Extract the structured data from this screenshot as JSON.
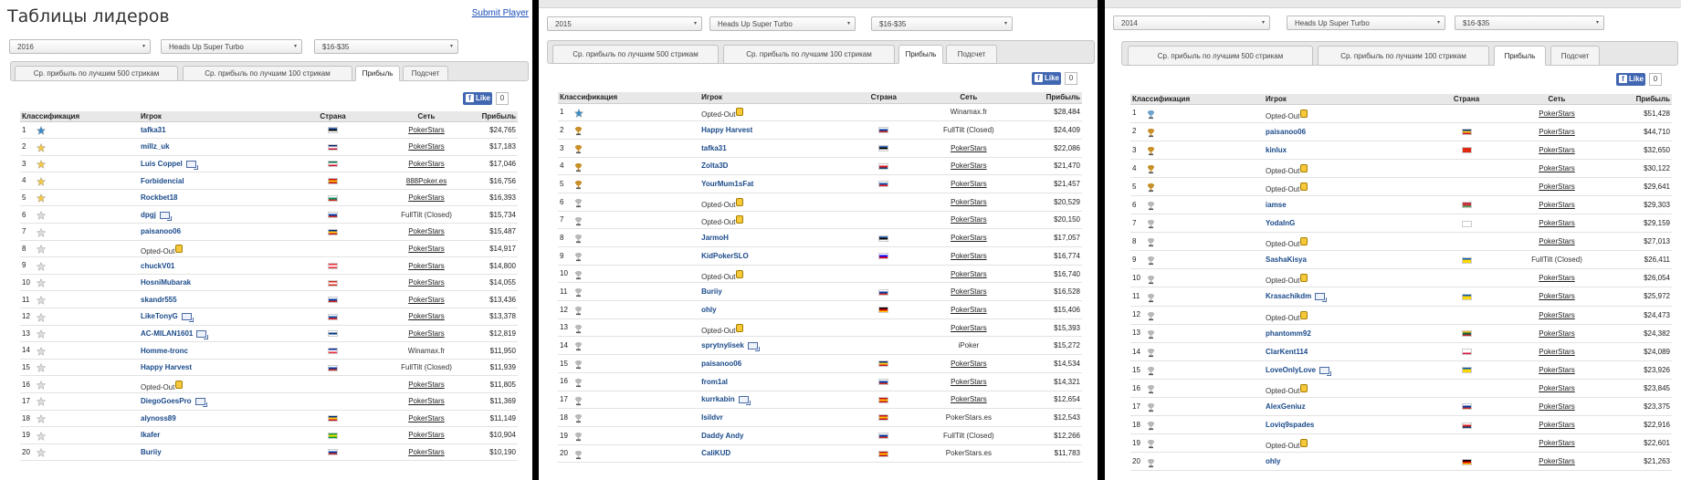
{
  "panels": [
    {
      "title": "Таблицы лидеров",
      "submit": "Submit Player",
      "filters": {
        "year": "2016",
        "game": "Heads Up Super Turbo",
        "stakes": "$16-$35"
      },
      "tabs": [
        "Ср. прибыль по лучшим 500 стрикам",
        "Ср. прибыль по лучшим 100 стрикам",
        "Прибыль",
        "Подсчет"
      ],
      "active_tab": 2,
      "fb": {
        "like": "Like",
        "count": "0"
      },
      "headers": {
        "rank": "Классификация",
        "player": "Игрок",
        "country": "Страна",
        "network": "Сеть",
        "profit": "Прибыль"
      },
      "rows": [
        {
          "rank": "1",
          "icon": "star-blue",
          "player": "tafka31",
          "flag": "ee",
          "network": "PokerStars",
          "profit": "$24,765"
        },
        {
          "rank": "2",
          "icon": "star-gold",
          "player": "millz_uk",
          "flag": "gb",
          "network": "PokerStars",
          "profit": "$17,183"
        },
        {
          "rank": "3",
          "icon": "star-gold",
          "player": "Luis Coppel",
          "popup": true,
          "flag": "mx",
          "network": "PokerStars",
          "profit": "$17,046"
        },
        {
          "rank": "4",
          "icon": "star-gold",
          "player": "Forbidencial",
          "flag": "es",
          "network": "888Poker.es",
          "profit": "$16,756"
        },
        {
          "rank": "5",
          "icon": "star-gold",
          "player": "Rockbet18",
          "flag": "bg",
          "network": "PokerStars",
          "profit": "$16,393"
        },
        {
          "rank": "6",
          "icon": "star-grey",
          "player": "dpgj",
          "popup": true,
          "flag": "ru",
          "network": "FullTilt (Closed)",
          "profit": "$15,734"
        },
        {
          "rank": "7",
          "icon": "star-grey",
          "player": "paisanoo06",
          "flag": "ro",
          "network": "PokerStars",
          "profit": "$15,487"
        },
        {
          "rank": "8",
          "icon": "star-grey",
          "player": "Opted-Out",
          "optout": true,
          "flag": "",
          "network": "PokerStars",
          "profit": "$14,917"
        },
        {
          "rank": "9",
          "icon": "star-grey",
          "player": "chuckV01",
          "flag": "at",
          "network": "PokerStars",
          "profit": "$14,800"
        },
        {
          "rank": "10",
          "icon": "star-grey",
          "player": "HosniMubarak",
          "flag": "ca",
          "network": "PokerStars",
          "profit": "$14,055"
        },
        {
          "rank": "11",
          "icon": "star-grey",
          "player": "skandr555",
          "flag": "ru",
          "network": "PokerStars",
          "profit": "$13,436"
        },
        {
          "rank": "12",
          "icon": "star-grey",
          "player": "LikeTonyG",
          "popup": true,
          "flag": "sk",
          "network": "PokerStars",
          "profit": "$13,378"
        },
        {
          "rank": "13",
          "icon": "star-grey",
          "player": "AC-MILAN1601",
          "popup": true,
          "flag": "fi",
          "network": "PokerStars",
          "profit": "$12,819"
        },
        {
          "rank": "14",
          "icon": "star-grey",
          "player": "Homme-tronc",
          "flag": "fr",
          "network": "Winamax.fr",
          "profit": "$11,950"
        },
        {
          "rank": "15",
          "icon": "star-grey",
          "player": "Happy Harvest",
          "flag": "ru",
          "network": "FullTilt (Closed)",
          "profit": "$11,939"
        },
        {
          "rank": "16",
          "icon": "star-grey",
          "player": "Opted-Out",
          "optout": true,
          "flag": "",
          "network": "PokerStars",
          "profit": "$11,805"
        },
        {
          "rank": "17",
          "icon": "star-grey",
          "player": "DiegoGoesPro",
          "popup": true,
          "flag": "",
          "network": "PokerStars",
          "profit": "$11,369"
        },
        {
          "rank": "18",
          "icon": "star-grey",
          "player": "alynoss89",
          "flag": "ro",
          "network": "PokerStars",
          "profit": "$11,149"
        },
        {
          "rank": "19",
          "icon": "star-grey",
          "player": "lkafer",
          "flag": "br",
          "network": "PokerStars",
          "profit": "$10,904"
        },
        {
          "rank": "20",
          "icon": "star-grey",
          "player": "Buriiy",
          "flag": "ru",
          "network": "PokerStars",
          "profit": "$10,190"
        }
      ]
    },
    {
      "filters": {
        "year": "2015",
        "game": "Heads Up Super Turbo",
        "stakes": "$16-$35"
      },
      "tabs": [
        "Ср. прибыль по лучшим 500 стрикам",
        "Ср. прибыль по лучшим 100 стрикам",
        "Прибыль",
        "Подсчет"
      ],
      "active_tab": 2,
      "fb": {
        "like": "Like",
        "count": "0"
      },
      "headers": {
        "rank": "Классификация",
        "player": "Игрок",
        "country": "Страна",
        "network": "Сеть",
        "profit": "Прибыль"
      },
      "rows": [
        {
          "rank": "1",
          "icon": "star-blue",
          "player": "Opted-Out",
          "optout": true,
          "flag": "",
          "network": "Winamax.fr",
          "profit": "$28,484"
        },
        {
          "rank": "2",
          "icon": "trophy",
          "player": "Happy Harvest",
          "flag": "ru",
          "network": "FullTilt (Closed)",
          "profit": "$24,409"
        },
        {
          "rank": "3",
          "icon": "trophy",
          "player": "tafka31",
          "flag": "ee",
          "network": "PokerStars",
          "profit": "$22,086"
        },
        {
          "rank": "4",
          "icon": "trophy",
          "player": "Zolta3D",
          "flag": "cz",
          "network": "PokerStars",
          "profit": "$21,470"
        },
        {
          "rank": "5",
          "icon": "trophy",
          "player": "YourMum1sFat",
          "flag": "sk",
          "network": "PokerStars",
          "profit": "$21,457"
        },
        {
          "rank": "6",
          "icon": "trophy-grey",
          "player": "Opted-Out",
          "optout": true,
          "flag": "",
          "network": "PokerStars",
          "profit": "$20,529"
        },
        {
          "rank": "7",
          "icon": "trophy-grey",
          "player": "Opted-Out",
          "optout": true,
          "flag": "",
          "network": "PokerStars",
          "profit": "$20,150"
        },
        {
          "rank": "8",
          "icon": "trophy-grey",
          "player": "JarmoH",
          "flag": "ee",
          "network": "PokerStars",
          "profit": "$17,057"
        },
        {
          "rank": "9",
          "icon": "trophy-grey",
          "player": "KidPokerSLO",
          "flag": "si",
          "network": "PokerStars",
          "profit": "$16,774"
        },
        {
          "rank": "10",
          "icon": "trophy-grey",
          "player": "Opted-Out",
          "optout": true,
          "flag": "",
          "network": "PokerStars",
          "profit": "$16,740"
        },
        {
          "rank": "11",
          "icon": "trophy-grey",
          "player": "Buriiy",
          "flag": "ru",
          "network": "PokerStars",
          "profit": "$16,528"
        },
        {
          "rank": "12",
          "icon": "trophy-grey",
          "player": "ohly",
          "flag": "de",
          "network": "PokerStars",
          "profit": "$15,406"
        },
        {
          "rank": "13",
          "icon": "trophy-grey",
          "player": "Opted-Out",
          "optout": true,
          "flag": "",
          "network": "PokerStars",
          "profit": "$15,393"
        },
        {
          "rank": "14",
          "icon": "trophy-grey",
          "player": "sprytnylisek",
          "popup": true,
          "flag": "",
          "network": "iPoker",
          "profit": "$15,272"
        },
        {
          "rank": "15",
          "icon": "trophy-grey",
          "player": "paisanoo06",
          "flag": "ro",
          "network": "PokerStars",
          "profit": "$14,534"
        },
        {
          "rank": "16",
          "icon": "trophy-grey",
          "player": "from1al",
          "flag": "ru",
          "network": "PokerStars",
          "profit": "$14,321"
        },
        {
          "rank": "17",
          "icon": "trophy-grey",
          "player": "kurrkabin",
          "popup": true,
          "flag": "es",
          "network": "PokerStars",
          "profit": "$12,654"
        },
        {
          "rank": "18",
          "icon": "trophy-grey",
          "player": "Isildvr",
          "flag": "es",
          "network": "PokerStars.es",
          "profit": "$12,543"
        },
        {
          "rank": "19",
          "icon": "trophy-grey",
          "player": "Daddy Andy",
          "flag": "ru",
          "network": "FullTilt (Closed)",
          "profit": "$12,266"
        },
        {
          "rank": "20",
          "icon": "trophy-grey",
          "player": "CaliKUD",
          "flag": "es",
          "network": "PokerStars.es",
          "profit": "$11,783"
        }
      ]
    },
    {
      "filters": {
        "year": "2014",
        "game": "Heads Up Super Turbo",
        "stakes": "$16-$35"
      },
      "tabs": [
        "Ср. прибыль по лучшим 500 стрикам",
        "Ср. прибыль по лучшим 100 стрикам",
        "Прибыль",
        "Подсчет"
      ],
      "active_tab": 2,
      "fb": {
        "like": "Like",
        "count": "0"
      },
      "headers": {
        "rank": "Классификация",
        "player": "Игрок",
        "country": "Страна",
        "network": "Сеть",
        "profit": "Прибыль"
      },
      "rows": [
        {
          "rank": "1",
          "icon": "trophy-blue",
          "player": "Opted-Out",
          "optout": true,
          "flag": "",
          "network": "PokerStars",
          "profit": "$51,428"
        },
        {
          "rank": "2",
          "icon": "trophy",
          "player": "paisanoo06",
          "flag": "ro",
          "network": "PokerStars",
          "profit": "$44,710"
        },
        {
          "rank": "3",
          "icon": "trophy",
          "player": "kinlux",
          "flag": "cn",
          "network": "PokerStars",
          "profit": "$32,650"
        },
        {
          "rank": "4",
          "icon": "trophy",
          "player": "Opted-Out",
          "optout": true,
          "flag": "",
          "network": "PokerStars",
          "profit": "$30,122"
        },
        {
          "rank": "5",
          "icon": "trophy",
          "player": "Opted-Out",
          "optout": true,
          "flag": "",
          "network": "PokerStars",
          "profit": "$29,641"
        },
        {
          "rank": "6",
          "icon": "trophy-grey",
          "player": "iamse",
          "flag": "by",
          "network": "PokerStars",
          "profit": "$29,303"
        },
        {
          "rank": "7",
          "icon": "trophy-grey",
          "player": "YodaInG",
          "flag": "kr",
          "network": "PokerStars",
          "profit": "$29,159"
        },
        {
          "rank": "8",
          "icon": "trophy-grey",
          "player": "Opted-Out",
          "optout": true,
          "flag": "",
          "network": "PokerStars",
          "profit": "$27,013"
        },
        {
          "rank": "9",
          "icon": "trophy-grey",
          "player": "SashaKisya",
          "flag": "ua",
          "network": "FullTilt (Closed)",
          "profit": "$26,411"
        },
        {
          "rank": "10",
          "icon": "trophy-grey",
          "player": "Opted-Out",
          "optout": true,
          "flag": "",
          "network": "PokerStars",
          "profit": "$26,054"
        },
        {
          "rank": "11",
          "icon": "trophy-grey",
          "player": "Krasachikdm",
          "popup": true,
          "flag": "ua",
          "network": "PokerStars",
          "profit": "$25,972"
        },
        {
          "rank": "12",
          "icon": "trophy-grey",
          "player": "Opted-Out",
          "optout": true,
          "flag": "",
          "network": "PokerStars",
          "profit": "$24,473"
        },
        {
          "rank": "13",
          "icon": "trophy-grey",
          "player": "phantomm92",
          "flag": "lt",
          "network": "PokerStars",
          "profit": "$24,382"
        },
        {
          "rank": "14",
          "icon": "trophy-grey",
          "player": "ClarKent114",
          "flag": "pl",
          "network": "PokerStars",
          "profit": "$24,089"
        },
        {
          "rank": "15",
          "icon": "trophy-grey",
          "player": "LoveOnlyLove",
          "popup": true,
          "flag": "ua",
          "network": "PokerStars",
          "profit": "$23,926"
        },
        {
          "rank": "16",
          "icon": "trophy-grey",
          "player": "Opted-Out",
          "optout": true,
          "flag": "",
          "network": "PokerStars",
          "profit": "$23,845"
        },
        {
          "rank": "17",
          "icon": "trophy-grey",
          "player": "AlexGeniuz",
          "flag": "ru",
          "network": "PokerStars",
          "profit": "$23,375"
        },
        {
          "rank": "18",
          "icon": "trophy-grey",
          "player": "Loviq9spades",
          "flag": "cz",
          "network": "PokerStars",
          "profit": "$22,916"
        },
        {
          "rank": "19",
          "icon": "trophy-grey",
          "player": "Opted-Out",
          "optout": true,
          "flag": "",
          "network": "PokerStars",
          "profit": "$22,601"
        },
        {
          "rank": "20",
          "icon": "trophy-grey",
          "player": "ohly",
          "flag": "de",
          "network": "PokerStars",
          "profit": "$21,263"
        }
      ]
    }
  ],
  "flag_colors": {
    "ee": [
      "#3a75c4",
      "#000000",
      "#ffffff"
    ],
    "gb": [
      "#012169",
      "#ffffff",
      "#c8102e"
    ],
    "mx": [
      "#006847",
      "#ffffff",
      "#ce1126"
    ],
    "es": [
      "#c60b1e",
      "#ffc400",
      "#c60b1e"
    ],
    "bg": [
      "#ffffff",
      "#00966e",
      "#d62612"
    ],
    "ru": [
      "#ffffff",
      "#0039a6",
      "#d52b1e"
    ],
    "ro": [
      "#002b7f",
      "#fcd116",
      "#ce1126"
    ],
    "at": [
      "#ed2939",
      "#ffffff",
      "#ed2939"
    ],
    "ca": [
      "#d52b1e",
      "#ffffff",
      "#d52b1e"
    ],
    "sk": [
      "#ffffff",
      "#0b4ea2",
      "#ee1c25"
    ],
    "fi": [
      "#ffffff",
      "#003580",
      "#ffffff"
    ],
    "fr": [
      "#002395",
      "#ffffff",
      "#ed2939"
    ],
    "br": [
      "#009c3b",
      "#ffdf00",
      "#009c3b"
    ],
    "cz": [
      "#ffffff",
      "#d7141a",
      "#11457e"
    ],
    "si": [
      "#ffffff",
      "#0000ff",
      "#ff0000"
    ],
    "de": [
      "#000000",
      "#dd0000",
      "#ffce00"
    ],
    "cn": [
      "#de2910",
      "#de2910",
      "#de2910"
    ],
    "by": [
      "#c8313e",
      "#c8313e",
      "#4aa657"
    ],
    "kr": [
      "#ffffff",
      "#ffffff",
      "#ffffff"
    ],
    "ua": [
      "#0057b7",
      "#ffd700",
      "#ffd700"
    ],
    "lt": [
      "#fdb913",
      "#006a44",
      "#c1272d"
    ],
    "pl": [
      "#ffffff",
      "#ffffff",
      "#dc143c"
    ]
  }
}
